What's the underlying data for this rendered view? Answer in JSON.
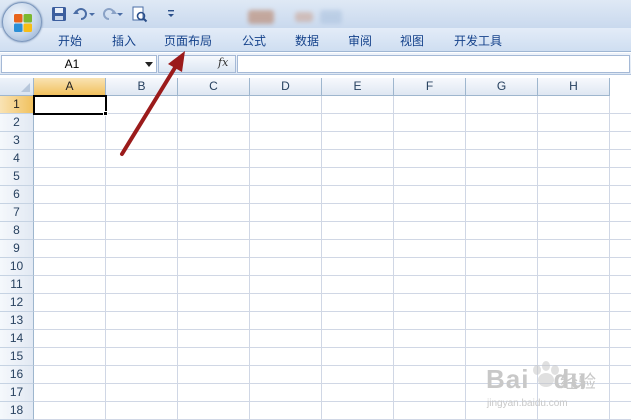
{
  "app": {
    "name_box_value": "A1",
    "fx_label": "fx"
  },
  "ribbon": {
    "tabs": [
      {
        "label": "开始"
      },
      {
        "label": "插入"
      },
      {
        "label": "页面布局"
      },
      {
        "label": "公式"
      },
      {
        "label": "数据"
      },
      {
        "label": "审阅"
      },
      {
        "label": "视图"
      },
      {
        "label": "开发工具"
      }
    ]
  },
  "quick_access": {
    "icons": [
      "save-icon",
      "undo-icon",
      "redo-icon",
      "print-preview-icon",
      "customize-toolbar-icon"
    ]
  },
  "sheet": {
    "columns": [
      "A",
      "B",
      "C",
      "D",
      "E",
      "F",
      "G",
      "H"
    ],
    "rows": [
      "1",
      "2",
      "3",
      "4",
      "5",
      "6",
      "7",
      "8",
      "9",
      "10",
      "11",
      "12",
      "13",
      "14",
      "15",
      "16",
      "17",
      "18"
    ],
    "active_column": "A",
    "active_row": "1"
  },
  "annotation": {
    "color": "#9b1b1b"
  },
  "watermark": {
    "logo_text": "Bai",
    "logo_text_2": "du",
    "cn_text": "经验",
    "url": "jingyan.baidu.com"
  },
  "colors": {
    "ribbon_text": "#15428b",
    "active_header": "#f1c15e"
  }
}
